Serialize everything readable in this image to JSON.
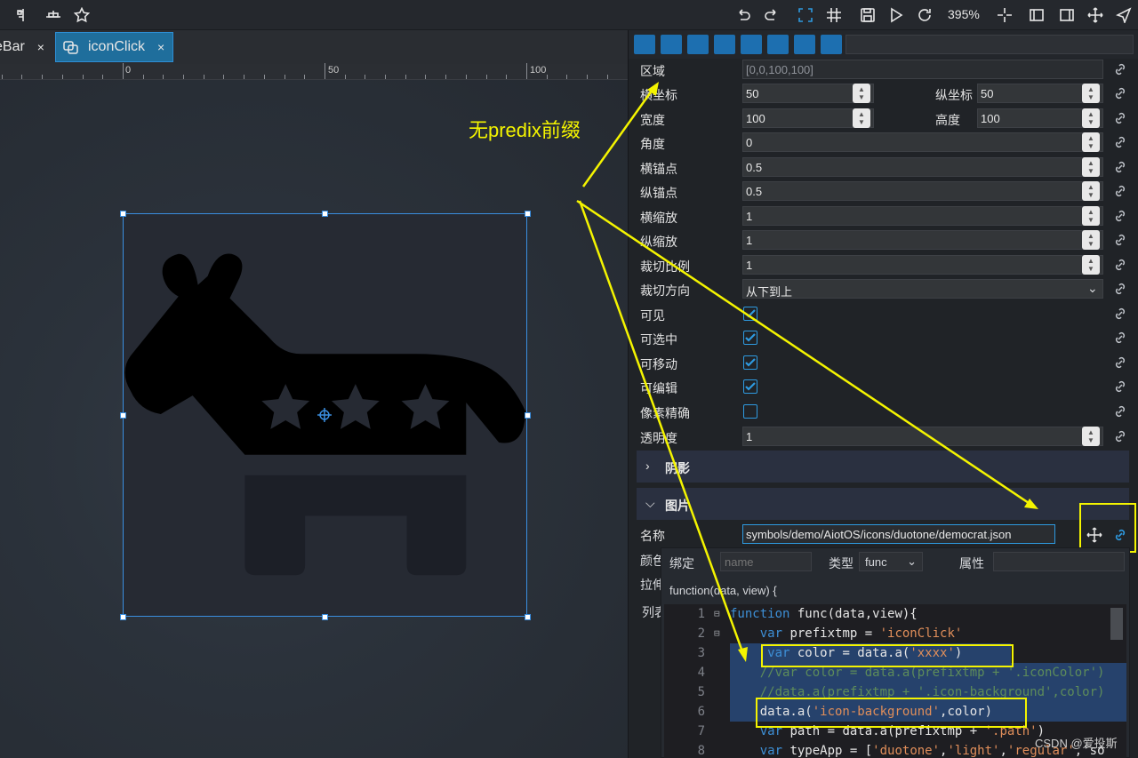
{
  "toolbar": {
    "left_icons": [
      "layout-vertical-icon",
      "layout-horizontal-icon",
      "star-icon"
    ],
    "right_icons": [
      "undo-icon",
      "redo-icon",
      "select-frame-icon",
      "grid-icon",
      "save-icon",
      "play-icon",
      "refresh-icon"
    ],
    "zoom": "395%",
    "right_icons_2": [
      "crosshair-icon",
      "panel-left-icon",
      "panel-right-icon",
      "move-icon",
      "send-icon"
    ]
  },
  "tabs": [
    {
      "label": "eBar",
      "close": "×"
    },
    {
      "label": "iconClick",
      "close": "×"
    }
  ],
  "ruler": {
    "labels": [
      "0",
      "50",
      "100"
    ]
  },
  "annotation": {
    "text": "无predix前缀"
  },
  "properties": {
    "region": {
      "label": "区域",
      "value": "[0,0,100,100]"
    },
    "x": {
      "label": "横坐标",
      "value": "50"
    },
    "y": {
      "label": "纵坐标",
      "value": "50"
    },
    "width": {
      "label": "宽度",
      "value": "100"
    },
    "height": {
      "label": "高度",
      "value": "100"
    },
    "angle": {
      "label": "角度",
      "value": "0"
    },
    "anchor_x": {
      "label": "横锚点",
      "value": "0.5"
    },
    "anchor_y": {
      "label": "纵锚点",
      "value": "0.5"
    },
    "scale_x": {
      "label": "横缩放",
      "value": "1"
    },
    "scale_y": {
      "label": "纵缩放",
      "value": "1"
    },
    "clip_ratio": {
      "label": "裁切比例",
      "value": "1"
    },
    "clip_direction": {
      "label": "裁切方向",
      "value": "从下到上"
    },
    "visible": {
      "label": "可见",
      "checked": true
    },
    "selectable": {
      "label": "可选中",
      "checked": true
    },
    "movable": {
      "label": "可移动",
      "checked": true
    },
    "editable": {
      "label": "可编辑",
      "checked": true
    },
    "pixel_precise": {
      "label": "像素精确",
      "checked": false
    },
    "opacity": {
      "label": "透明度",
      "value": "1"
    }
  },
  "sections": {
    "shadow": "阴影",
    "image": "图片"
  },
  "image": {
    "name_label": "名称",
    "name_value": "symbols/demo/AiotOS/icons/duotone/democrat.json",
    "color_label_partial": "颜色",
    "stretch_label_partial": "拉伸",
    "list_label_partial": "列表"
  },
  "binding": {
    "bind_label": "绑定",
    "name_placeholder": "name",
    "type_label": "类型",
    "type_value": "func",
    "attr_label": "属性",
    "signature": "function(data, view) {"
  },
  "code": [
    {
      "n": "1",
      "fold": true,
      "text": "function func(data,view){"
    },
    {
      "n": "2",
      "fold": true,
      "text": "    var prefixtmp = 'iconClick'"
    },
    {
      "n": "3",
      "fold": false,
      "text": "     var color = data.a('xxxx')"
    },
    {
      "n": "4",
      "fold": false,
      "text": "    //var color = data.a(prefixtmp + '.iconColor')"
    },
    {
      "n": "5",
      "fold": false,
      "text": "    //data.a(prefixtmp + '.icon-background',color)"
    },
    {
      "n": "6",
      "fold": false,
      "text": "    data.a('icon-background',color)"
    },
    {
      "n": "7",
      "fold": false,
      "text": "    var path = data.a(prefixtmp + '.path')"
    },
    {
      "n": "8",
      "fold": false,
      "text": "    var typeApp = ['duotone','light','regular','so"
    }
  ],
  "watermark": "CSDN @爱投斯",
  "colors": {
    "accent": "#2e9ae0",
    "annotation": "#f4f400",
    "selection": "#3a8ee0"
  }
}
